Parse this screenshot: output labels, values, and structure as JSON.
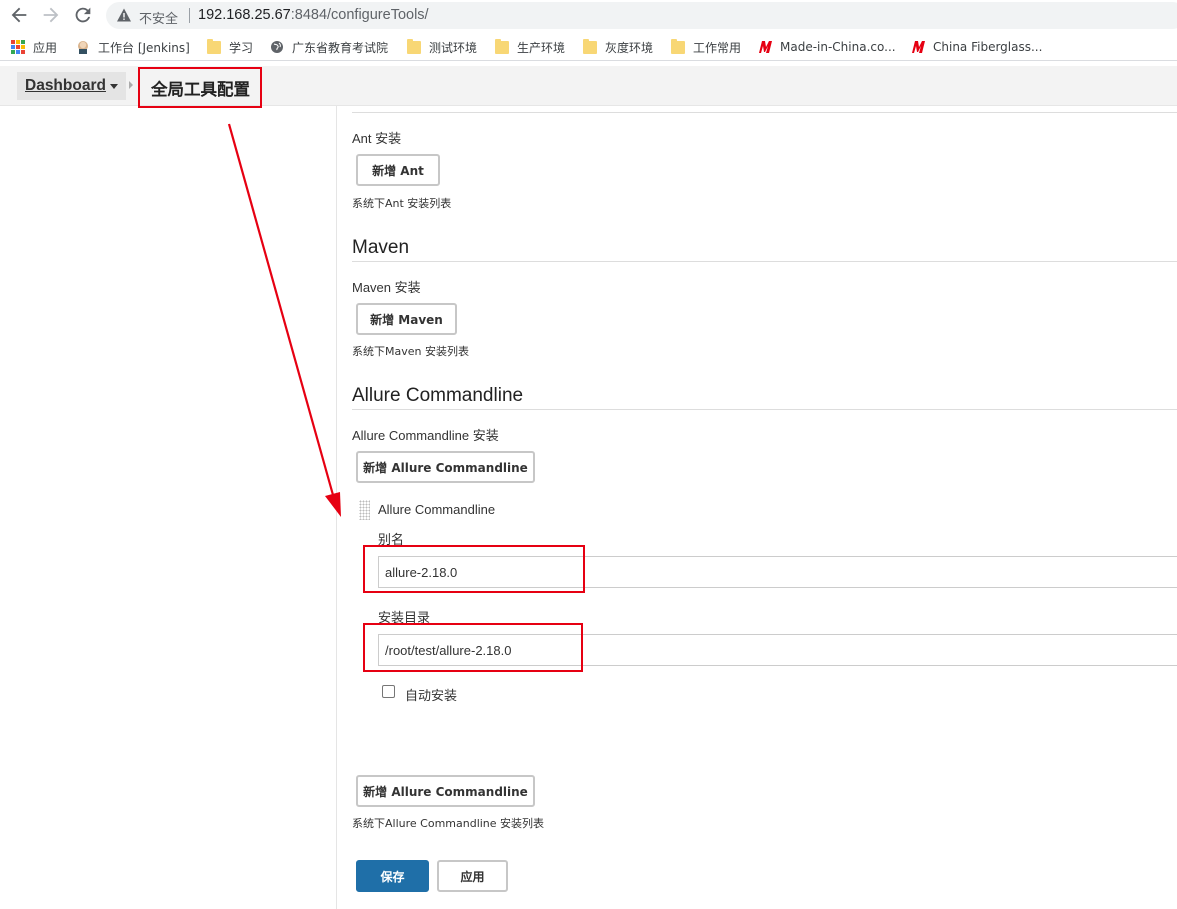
{
  "browser": {
    "insecure_label": "不安全",
    "url_host": "192.168.25.67",
    "url_path": ":8484/configureTools/",
    "bookmarks": [
      {
        "label": "应用",
        "icon": "apps-grid-icon"
      },
      {
        "label": "工作台 [Jenkins]",
        "icon": "jenkins-icon"
      },
      {
        "label": "学习",
        "icon": "folder-icon"
      },
      {
        "label": "广东省教育考试院",
        "icon": "globe-icon"
      },
      {
        "label": "测试环境",
        "icon": "folder-icon"
      },
      {
        "label": "生产环境",
        "icon": "folder-icon"
      },
      {
        "label": "灰度环境",
        "icon": "folder-icon"
      },
      {
        "label": "工作常用",
        "icon": "folder-icon"
      },
      {
        "label": "Made-in-China.co...",
        "icon": "made-in-china-icon"
      },
      {
        "label": "China Fiberglass...",
        "icon": "made-in-china-icon"
      }
    ]
  },
  "breadcrumb": {
    "dashboard": "Dashboard",
    "current_page": "全局工具配置"
  },
  "ant": {
    "install_label_en": "Ant",
    "install_label_cn": "安装",
    "add_button": "新增 Ant",
    "hint": "系统下Ant 安装列表"
  },
  "maven": {
    "title": "Maven",
    "install_label_en": "Maven",
    "install_label_cn": "安装",
    "add_button": "新增 Maven",
    "hint": "系统下Maven 安装列表"
  },
  "allure": {
    "title": "Allure Commandline",
    "install_label_en": "Allure Commandline",
    "install_label_cn": "安装",
    "add_button_top": "新增 Allure Commandline",
    "installation": {
      "name": "Allure Commandline",
      "alias_label": "别名",
      "alias_value": "allure-2.18.0",
      "home_label": "安装目录",
      "home_value": "/root/test/allure-2.18.0",
      "auto_install_label": "自动安装",
      "auto_install_checked": false
    },
    "add_button_bottom": "新增 Allure Commandline",
    "hint": "系统下Allure Commandline 安装列表"
  },
  "footer": {
    "save_button": "保存",
    "apply_button": "应用"
  },
  "colors": {
    "annotation": "#e60012",
    "primary": "#1f6fa8"
  }
}
